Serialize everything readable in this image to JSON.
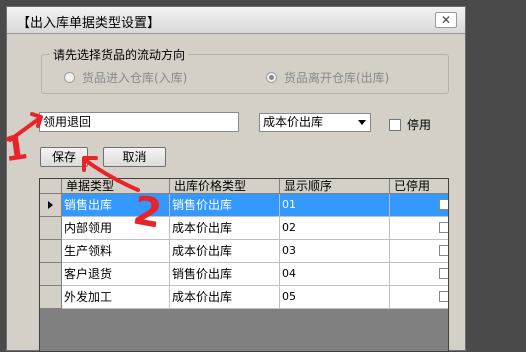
{
  "window": {
    "title": "【出入库单据类型设置】",
    "close_glyph": "✕"
  },
  "direction_group": {
    "legend": "请先选择货品的流动方向",
    "options": [
      {
        "label": "货品进入仓库(入库)",
        "checked": false
      },
      {
        "label": "货品离开仓库(出库)",
        "checked": true
      }
    ]
  },
  "form": {
    "name_value": "领用退回",
    "price_type_selected": "成本价出库",
    "disabled_label": "停用"
  },
  "buttons": {
    "save": "保存",
    "cancel": "取消"
  },
  "grid": {
    "columns": [
      "单据类型",
      "出库价格类型",
      "显示顺序",
      "已停用"
    ],
    "rows": [
      {
        "type": "销售出库",
        "price": "销售价出库",
        "order": "01",
        "disabled": false,
        "selected": true
      },
      {
        "type": "内部领用",
        "price": "成本价出库",
        "order": "02",
        "disabled": false,
        "selected": false
      },
      {
        "type": "生产领料",
        "price": "成本价出库",
        "order": "03",
        "disabled": false,
        "selected": false
      },
      {
        "type": "客户退货",
        "price": "销售价出库",
        "order": "04",
        "disabled": false,
        "selected": false
      },
      {
        "type": "外发加工",
        "price": "成本价出库",
        "order": "05",
        "disabled": false,
        "selected": false
      }
    ]
  },
  "annotations": {
    "mark_1": "1",
    "mark_2": "2",
    "color": "#e8232a"
  },
  "colors": {
    "selection": "#3399ff",
    "window_bg": "#d4d0c8",
    "grid_bg": "#808080"
  }
}
